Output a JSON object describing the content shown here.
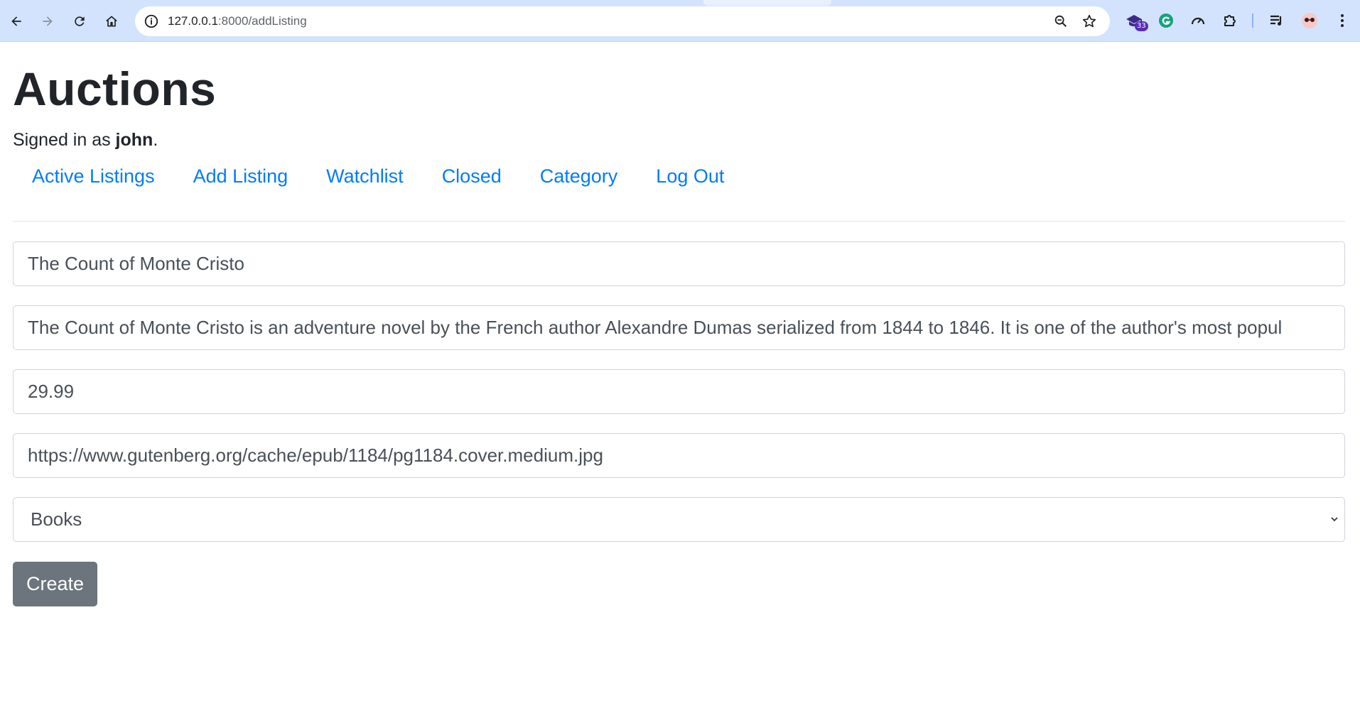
{
  "browser": {
    "url_host": "127.0.0.1",
    "url_rest": ":8000/addListing",
    "extension_badge": "33"
  },
  "header": {
    "title": "Auctions",
    "signed_in_prefix": "Signed in as ",
    "username": "john",
    "signed_in_suffix": "."
  },
  "nav": {
    "items": [
      {
        "label": "Active Listings"
      },
      {
        "label": "Add Listing"
      },
      {
        "label": "Watchlist"
      },
      {
        "label": "Closed"
      },
      {
        "label": "Category"
      },
      {
        "label": "Log Out"
      }
    ]
  },
  "form": {
    "title_value": "The Count of Monte Cristo",
    "description_value": "The Count of Monte Cristo is an adventure novel by the French author Alexandre Dumas serialized from 1844 to 1846. It is one of the author's most popul",
    "price_value": "29.99",
    "image_url_value": "https://www.gutenberg.org/cache/epub/1184/pg1184.cover.medium.jpg",
    "category_selected": "Books",
    "submit_label": "Create"
  },
  "colors": {
    "link": "#007bff",
    "button": "#6c757d",
    "chrome": "#d3e3fd"
  }
}
